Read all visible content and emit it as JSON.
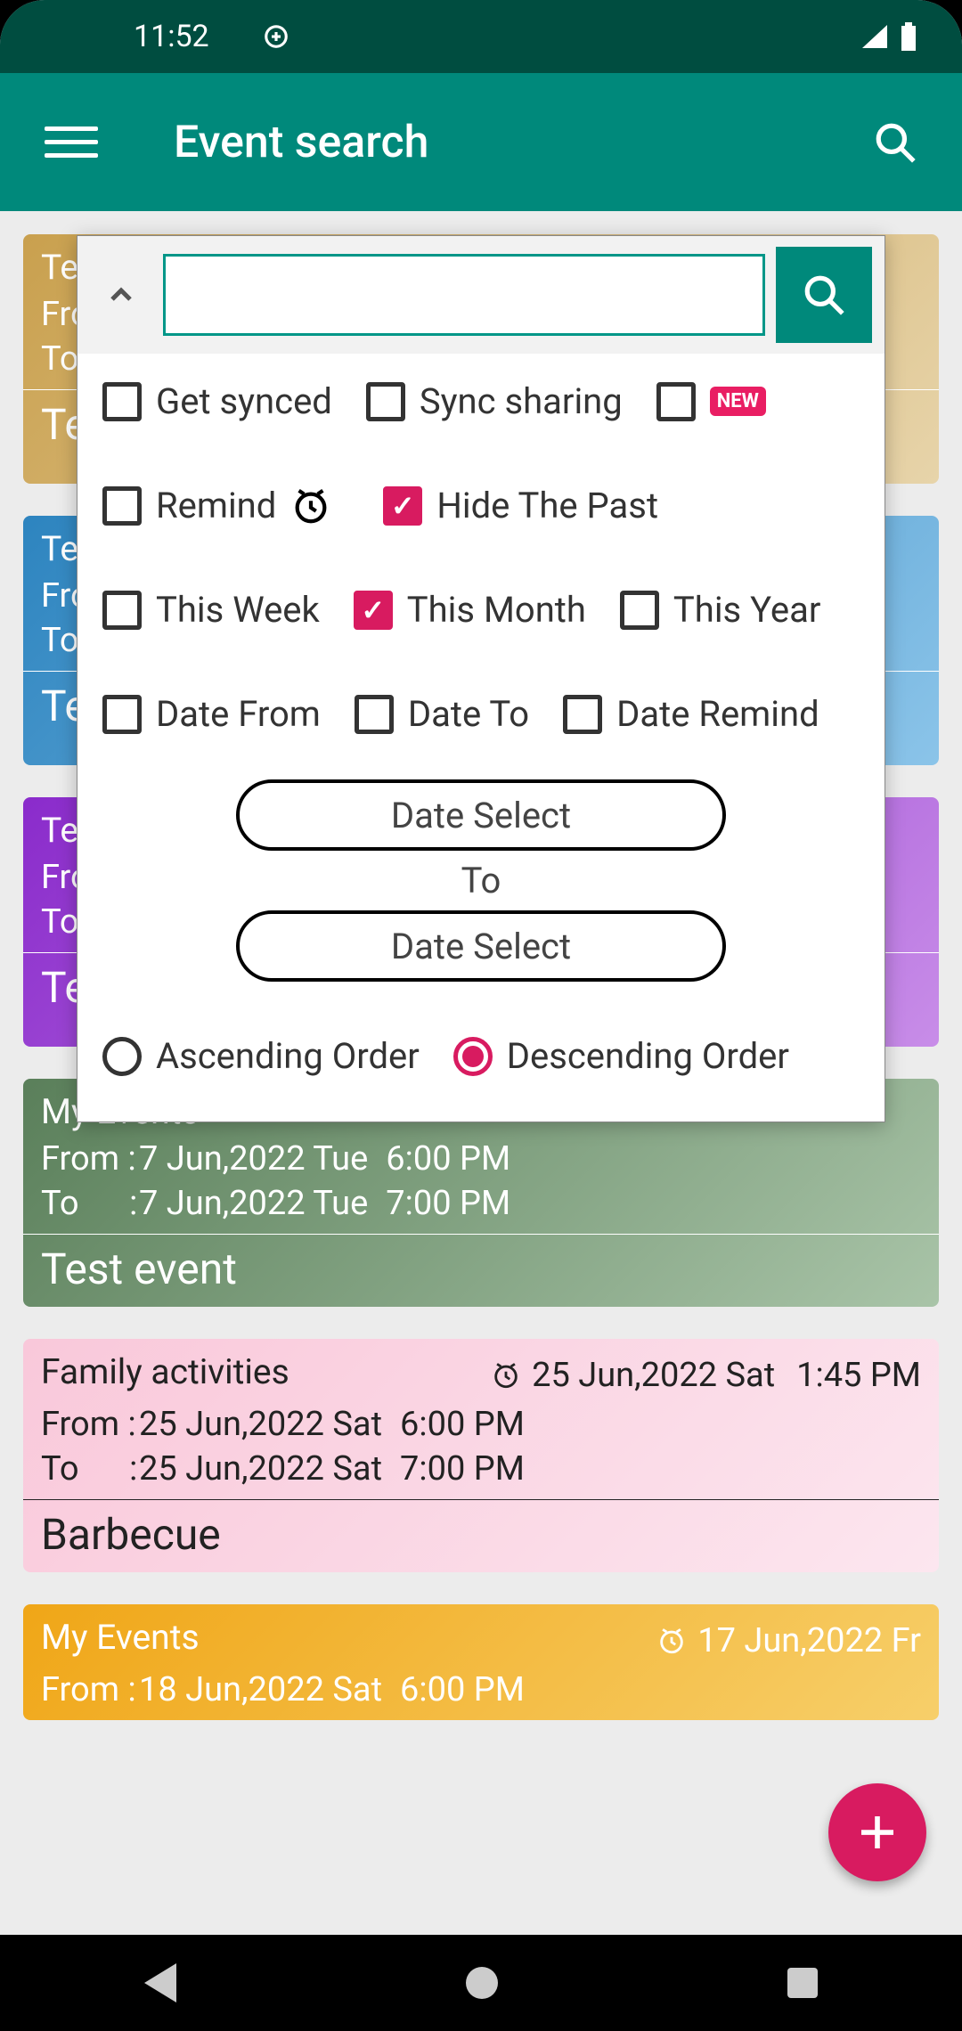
{
  "status": {
    "time": "11:52"
  },
  "header": {
    "title": "Event search"
  },
  "filters": {
    "get_synced": {
      "label": "Get synced",
      "checked": false
    },
    "sync_sharing": {
      "label": "Sync sharing",
      "checked": false,
      "new": true
    },
    "remind": {
      "label": "Remind",
      "checked": false
    },
    "hide_past": {
      "label": "Hide The Past",
      "checked": true
    },
    "this_week": {
      "label": "This Week",
      "checked": false
    },
    "this_month": {
      "label": "This Month",
      "checked": true
    },
    "this_year": {
      "label": "This Year",
      "checked": false
    },
    "date_from": {
      "label": "Date From",
      "checked": false
    },
    "date_to": {
      "label": "Date To",
      "checked": false
    },
    "date_remind": {
      "label": "Date Remind",
      "checked": false
    },
    "date_select_a": "Date Select",
    "to_label": "To",
    "date_select_b": "Date Select",
    "order_asc": {
      "label": "Ascending Order",
      "selected": false
    },
    "order_desc": {
      "label": "Descending Order",
      "selected": true
    }
  },
  "events": [
    {
      "category": "Te",
      "from_label": "From",
      "to_label": "To",
      "title": "Te",
      "color": "tan"
    },
    {
      "category": "Te",
      "from_label": "From",
      "to_label": "To",
      "title": "Te",
      "color": "blue"
    },
    {
      "category": "Te",
      "from_label": "From",
      "to_label": "To",
      "title": "Te",
      "color": "purple"
    },
    {
      "category": "My Events",
      "from_label": "From :",
      "from_date": "7 Jun,2022 Tue",
      "from_time": "6:00 PM",
      "to_label": "To      :",
      "to_date": "7 Jun,2022 Tue",
      "to_time": "7:00 PM",
      "title": "Test event",
      "color": "green"
    },
    {
      "category": "Family activities",
      "alarm_date": "25 Jun,2022 Sat",
      "alarm_time": "1:45 PM",
      "from_label": "From :",
      "from_date": "25 Jun,2022 Sat",
      "from_time": "6:00 PM",
      "to_label": "To      :",
      "to_date": "25 Jun,2022 Sat",
      "to_time": "7:00 PM",
      "title": "Barbecue",
      "color": "pink"
    },
    {
      "category": "My Events",
      "alarm_date": "17 Jun,2022 Fr",
      "from_label": "From :",
      "from_date": "18 Jun,2022 Sat",
      "from_time": "6:00 PM",
      "color": "yellow"
    }
  ]
}
